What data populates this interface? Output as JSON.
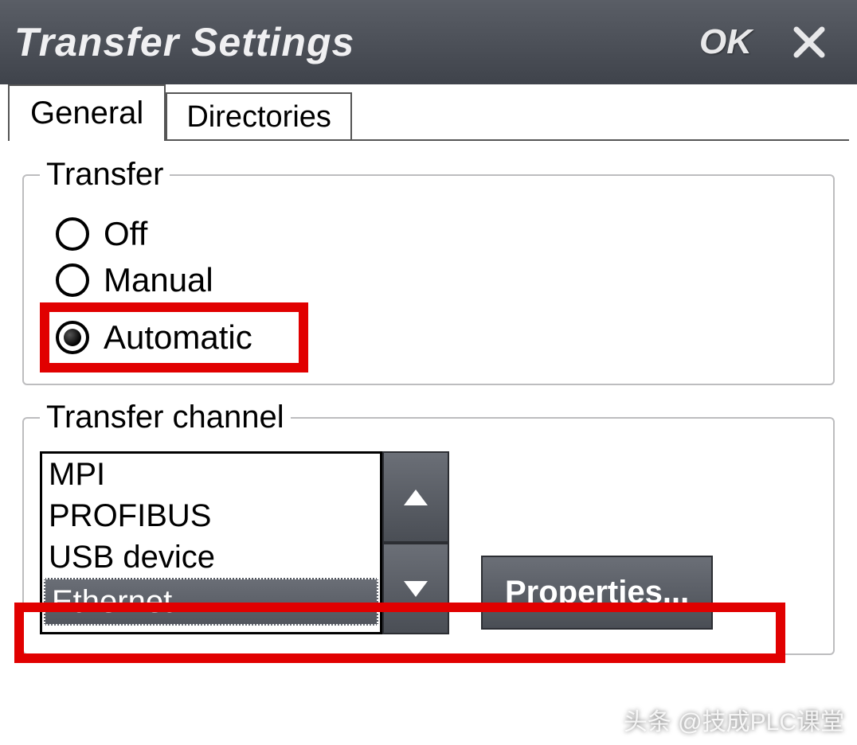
{
  "titlebar": {
    "title": "Transfer Settings",
    "ok_label": "OK"
  },
  "tabs": {
    "general": "General",
    "directories": "Directories"
  },
  "transfer_group": {
    "legend": "Transfer",
    "options": {
      "off": "Off",
      "manual": "Manual",
      "automatic": "Automatic"
    },
    "selected": "automatic"
  },
  "channel_group": {
    "legend": "Transfer channel",
    "items": [
      "MPI",
      "PROFIBUS",
      "USB device",
      "Ethernet"
    ],
    "selected_index": 3,
    "properties_label": "Properties..."
  },
  "watermark": "头条 @技成PLC课堂"
}
